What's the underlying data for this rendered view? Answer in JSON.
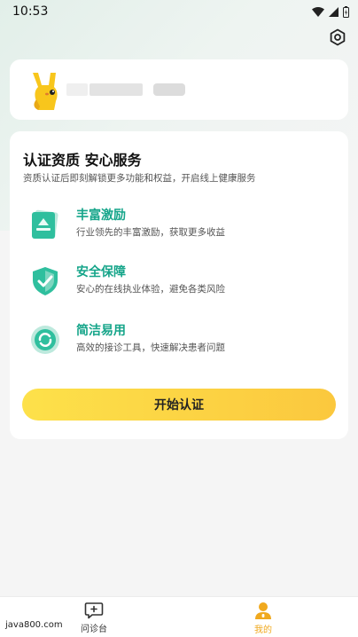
{
  "status_bar": {
    "time": "10:53"
  },
  "profile": {
    "mascot": "yellow-rabbit-mascot-icon"
  },
  "certification": {
    "title": "认证资质 安心服务",
    "subtitle": "资质认证后即刻解锁更多功能和权益，开启线上健康服务",
    "features": [
      {
        "icon": "certificate-stack-icon",
        "title": "丰富激励",
        "desc": "行业领先的丰富激励，获取更多收益"
      },
      {
        "icon": "shield-check-icon",
        "title": "安全保障",
        "desc": "安心的在线执业体验，避免各类风险"
      },
      {
        "icon": "refresh-circle-icon",
        "title": "简洁易用",
        "desc": "高效的接诊工具，快速解决患者问题"
      }
    ],
    "start_button": "开始认证"
  },
  "tabbar": {
    "tabs": [
      {
        "label": "问诊台",
        "icon": "consult-chat-icon",
        "active": false
      },
      {
        "label": "我的",
        "icon": "person-icon",
        "active": true
      }
    ]
  },
  "watermark": "java800.com",
  "colors": {
    "accent": "#16a58a",
    "button": "#fcd243",
    "active_tab": "#f0a91e"
  }
}
